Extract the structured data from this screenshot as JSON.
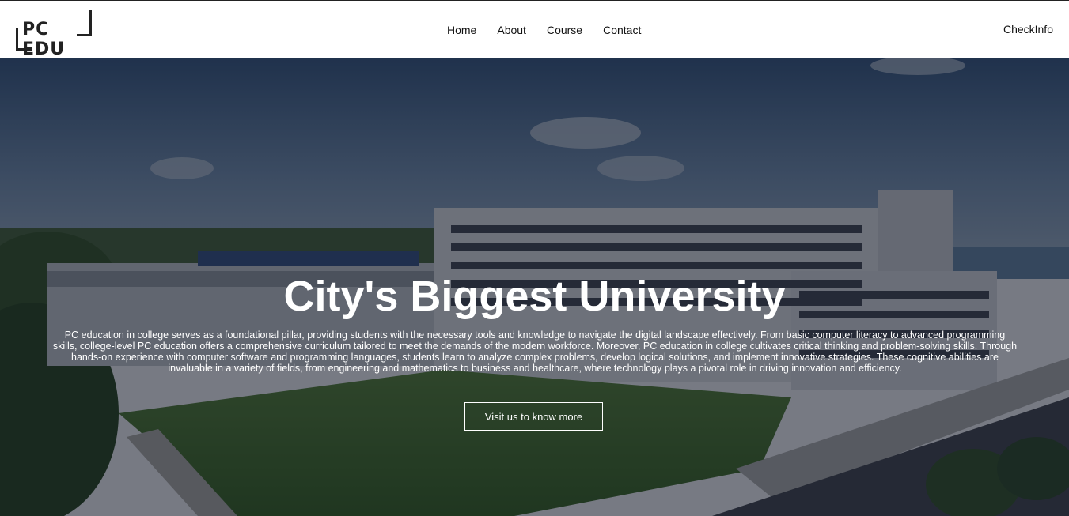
{
  "brand": {
    "logo_text": "PC EDU"
  },
  "nav": {
    "links": [
      "Home",
      "About",
      "Course",
      "Contact"
    ],
    "right_link": "CheckInfo"
  },
  "hero": {
    "title": "City's Biggest University",
    "description": "PC education in college serves as a foundational pillar, providing students with the necessary tools and knowledge to navigate the digital landscape effectively. From basic computer literacy to advanced programming skills, college-level PC education offers a comprehensive curriculum tailored to meet the demands of the modern workforce. Moreover, PC education in college cultivates critical thinking and problem-solving skills. Through hands-on experience with computer software and programming languages, students learn to analyze complex problems, develop logical solutions, and implement innovative strategies. These cognitive abilities are invaluable in a variety of fields, from engineering and mathematics to business and healthcare, where technology plays a pivotal role in driving innovation and efficiency.",
    "button_label": "Visit us to know more"
  },
  "colors": {
    "navbar_bg": "#ffffff",
    "overlay": "rgba(8,12,30,0.55)",
    "text_light": "#ffffff",
    "text_dark": "#111111"
  }
}
